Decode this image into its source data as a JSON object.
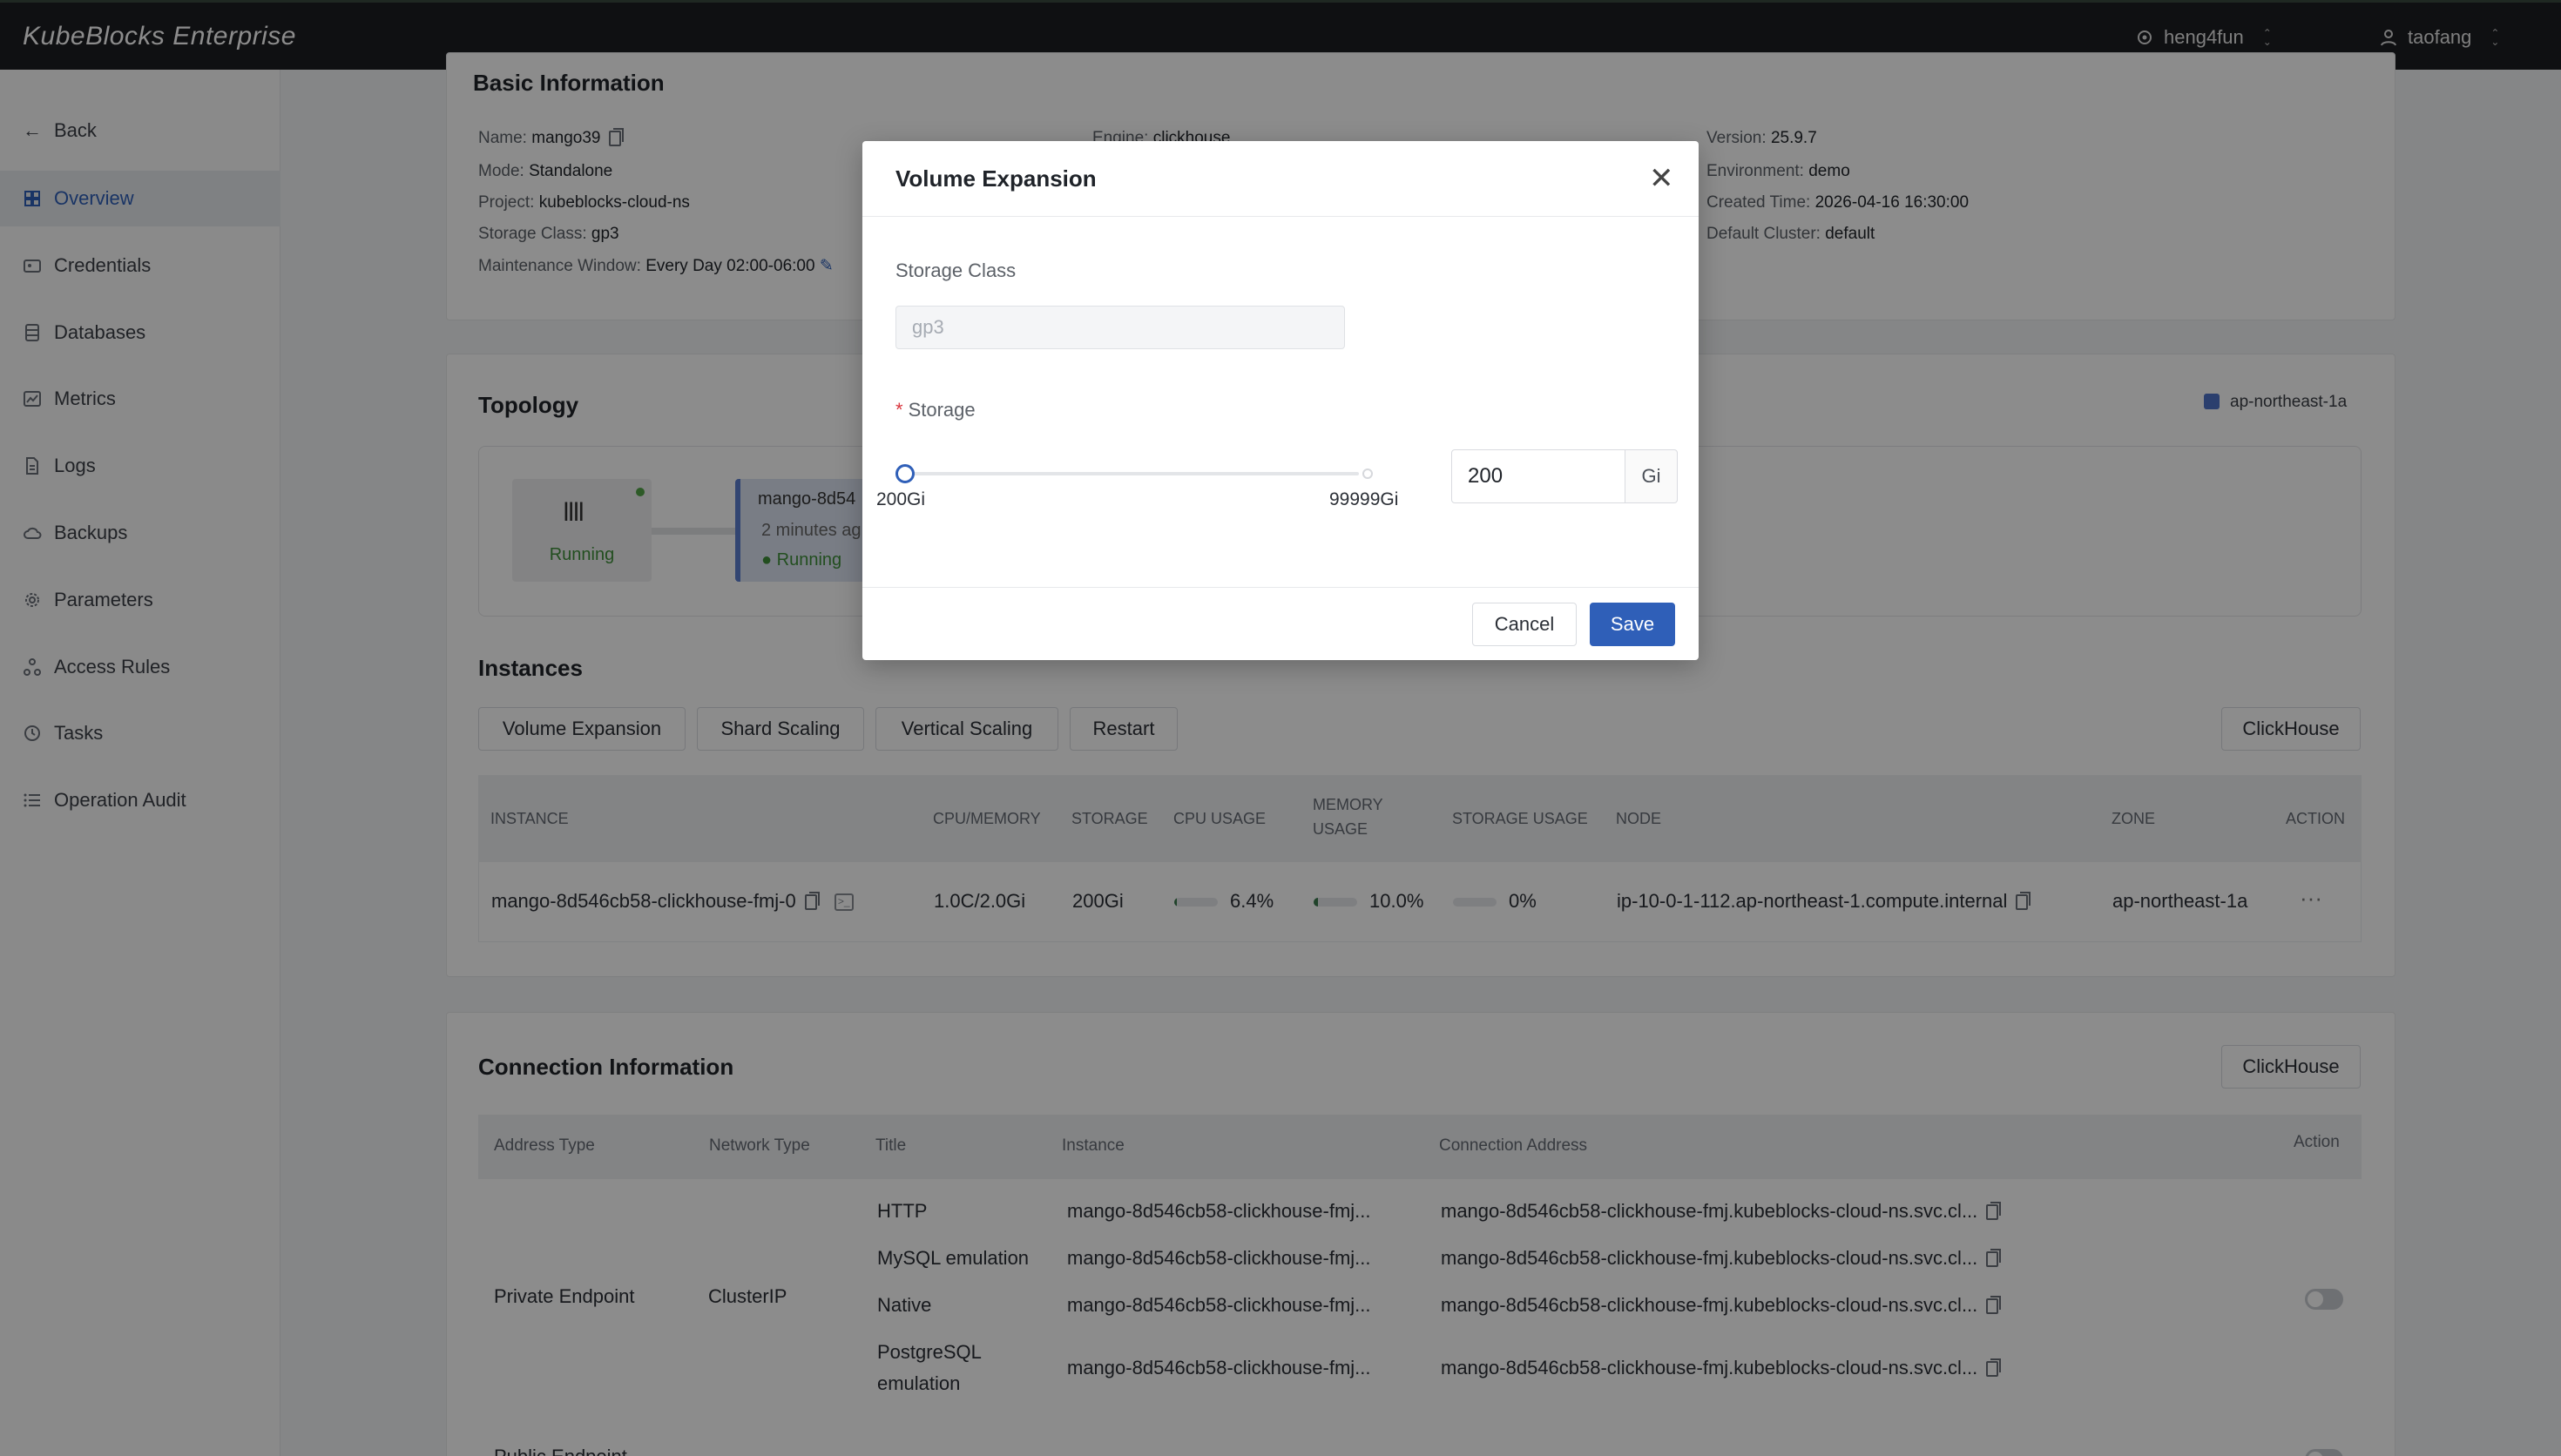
{
  "app": {
    "brand": "KubeBlocks Enterprise"
  },
  "topbar": {
    "org": "heng4fun",
    "user": "taofang"
  },
  "sidebar": {
    "items": [
      {
        "label": "Back",
        "icon": "arrow-left-icon"
      },
      {
        "label": "Overview",
        "icon": "grid-icon",
        "active": true
      },
      {
        "label": "Credentials",
        "icon": "credential-icon"
      },
      {
        "label": "Databases",
        "icon": "database-icon"
      },
      {
        "label": "Metrics",
        "icon": "chart-icon"
      },
      {
        "label": "Logs",
        "icon": "file-icon"
      },
      {
        "label": "Backups",
        "icon": "cloud-backup-icon"
      },
      {
        "label": "Parameters",
        "icon": "gear-icon"
      },
      {
        "label": "Access Rules",
        "icon": "network-icon"
      },
      {
        "label": "Tasks",
        "icon": "clock-icon"
      },
      {
        "label": "Operation Audit",
        "icon": "list-icon"
      }
    ]
  },
  "basic": {
    "title": "Basic Information",
    "name_k": "Name:",
    "name_v": "mango39",
    "mode_k": "Mode:",
    "mode_v": "Standalone",
    "project_k": "Project:",
    "project_v": "kubeblocks-cloud-ns",
    "storage_class_k": "Storage Class:",
    "storage_class_v": "gp3",
    "maint_k": "Maintenance Window:",
    "maint_v": "Every Day 02:00-06:00",
    "engine_k": "Engine:",
    "engine_v": "clickhouse",
    "version_k": "Version:",
    "version_v": "25.9.7",
    "env_k": "Environment:",
    "env_v": "demo",
    "created_k": "Created Time:",
    "created_v": "2026-04-16 16:30:00",
    "cluster_k": "Default Cluster:",
    "cluster_v": "default"
  },
  "topology": {
    "title": "Topology",
    "legend": "ap-northeast-1a",
    "node_status": "Running",
    "pod_name": "mango-8d54",
    "pod_age": "2 minutes ag",
    "pod_status": "Running"
  },
  "instances": {
    "title": "Instances",
    "actions": [
      "Volume Expansion",
      "Shard Scaling",
      "Vertical Scaling",
      "Restart"
    ],
    "engine_button": "ClickHouse",
    "headers": [
      "INSTANCE",
      "CPU/MEMORY",
      "STORAGE",
      "CPU USAGE",
      "MEMORY USAGE",
      "STORAGE USAGE",
      "NODE",
      "ZONE",
      "ACTION"
    ],
    "row": {
      "instance": "mango-8d546cb58-clickhouse-fmj-0",
      "cpu_mem": "1.0C/2.0Gi",
      "storage": "200Gi",
      "cpu_usage": "6.4%",
      "cpu_fraction": 0.064,
      "mem_usage": "10.0%",
      "mem_fraction": 0.1,
      "storage_usage": "0%",
      "storage_fraction": 0,
      "node": "ip-10-0-1-112.ap-northeast-1.compute.internal",
      "zone": "ap-northeast-1a",
      "action": "···"
    }
  },
  "connection": {
    "title": "Connection Information",
    "engine_button": "ClickHouse",
    "headers": [
      "Address Type",
      "Network Type",
      "Title",
      "Instance",
      "Connection Address",
      "Action"
    ],
    "address_type": "Private Endpoint",
    "network_type": "ClusterIP",
    "rows": [
      {
        "title": "HTTP",
        "instance": "mango-8d546cb58-clickhouse-fmj...",
        "address": "mango-8d546cb58-clickhouse-fmj.kubeblocks-cloud-ns.svc.cl..."
      },
      {
        "title": "MySQL emulation",
        "instance": "mango-8d546cb58-clickhouse-fmj...",
        "address": "mango-8d546cb58-clickhouse-fmj.kubeblocks-cloud-ns.svc.cl..."
      },
      {
        "title": "Native",
        "instance": "mango-8d546cb58-clickhouse-fmj...",
        "address": "mango-8d546cb58-clickhouse-fmj.kubeblocks-cloud-ns.svc.cl..."
      },
      {
        "title_line1": "PostgreSQL",
        "title_line2": "emulation",
        "instance": "mango-8d546cb58-clickhouse-fmj...",
        "address": "mango-8d546cb58-clickhouse-fmj.kubeblocks-cloud-ns.svc.cl..."
      }
    ],
    "next_row_partial": "Public Endpoint"
  },
  "modal": {
    "title": "Volume Expansion",
    "storage_class_label": "Storage Class",
    "storage_class_placeholder": "gp3",
    "storage_label": "Storage",
    "required_mark": "*",
    "slider_min": "200Gi",
    "slider_max": "99999Gi",
    "storage_value": "200",
    "unit": "Gi",
    "cancel": "Cancel",
    "save": "Save"
  },
  "colors": {
    "accent": "#2f5fb8",
    "topbar": "#1d1e22",
    "running": "#52a447"
  }
}
